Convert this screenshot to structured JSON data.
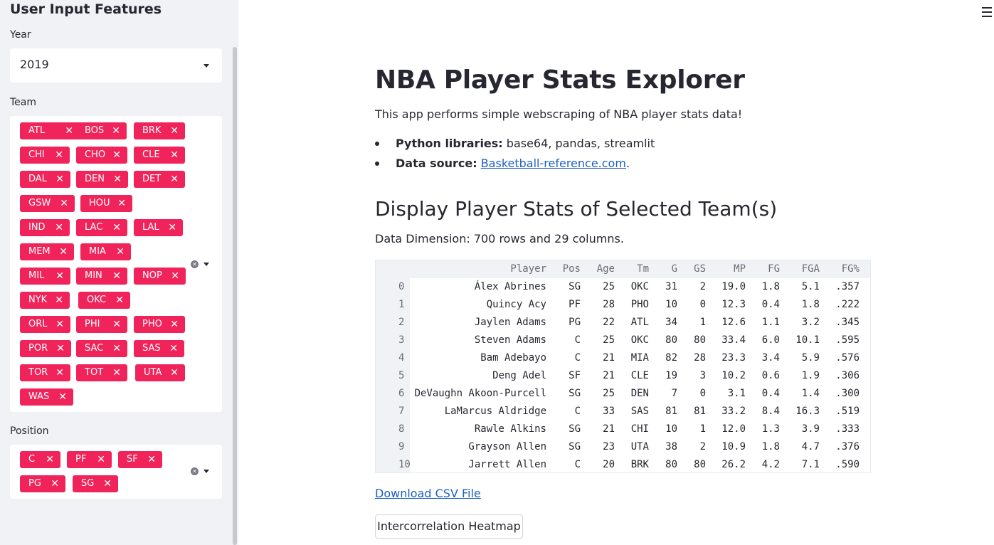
{
  "sidebar": {
    "title": "User Input Features",
    "year_label": "Year",
    "year_value": "2019",
    "team_label": "Team",
    "teams": [
      "ATL",
      "BOS",
      "BRK",
      "CHI",
      "CHO",
      "CLE",
      "DAL",
      "DEN",
      "DET",
      "GSW",
      "HOU",
      "IND",
      "LAC",
      "LAL",
      "MEM",
      "MIA",
      "MIL",
      "MIN",
      "NOP",
      "NYK",
      "OKC",
      "ORL",
      "PHI",
      "PHO",
      "POR",
      "SAC",
      "SAS",
      "TOR",
      "TOT",
      "UTA",
      "WAS"
    ],
    "position_label": "Position",
    "positions": [
      "C",
      "PF",
      "SF",
      "PG",
      "SG"
    ],
    "tag_remove_glyph": "✕",
    "clear_glyph": "✕"
  },
  "main": {
    "title": "NBA Player Stats Explorer",
    "intro": "This app performs simple webscraping of NBA player stats data!",
    "bullets": [
      {
        "bold": "Python libraries:",
        "text": " base64, pandas, streamlit"
      },
      {
        "bold": "Data source:",
        "link": "Basketball-reference.com",
        "suffix": "."
      }
    ],
    "subtitle": "Display Player Stats of Selected Team(s)",
    "dimensions": "Data Dimension: 700 rows and 29 columns.",
    "table": {
      "columns": [
        "Player",
        "Pos",
        "Age",
        "Tm",
        "G",
        "GS",
        "MP",
        "FG",
        "FGA",
        "FG%"
      ],
      "rows": [
        [
          "0",
          "Álex Abrines",
          "SG",
          "25",
          "OKC",
          "31",
          "2",
          "19.0",
          "1.8",
          "5.1",
          ".357"
        ],
        [
          "1",
          "Quincy Acy",
          "PF",
          "28",
          "PHO",
          "10",
          "0",
          "12.3",
          "0.4",
          "1.8",
          ".222"
        ],
        [
          "2",
          "Jaylen Adams",
          "PG",
          "22",
          "ATL",
          "34",
          "1",
          "12.6",
          "1.1",
          "3.2",
          ".345"
        ],
        [
          "3",
          "Steven Adams",
          "C",
          "25",
          "OKC",
          "80",
          "80",
          "33.4",
          "6.0",
          "10.1",
          ".595"
        ],
        [
          "4",
          "Bam Adebayo",
          "C",
          "21",
          "MIA",
          "82",
          "28",
          "23.3",
          "3.4",
          "5.9",
          ".576"
        ],
        [
          "5",
          "Deng Adel",
          "SF",
          "21",
          "CLE",
          "19",
          "3",
          "10.2",
          "0.6",
          "1.9",
          ".306"
        ],
        [
          "6",
          "DeVaughn Akoon-Purcell",
          "SG",
          "25",
          "DEN",
          "7",
          "0",
          "3.1",
          "0.4",
          "1.4",
          ".300"
        ],
        [
          "7",
          "LaMarcus Aldridge",
          "C",
          "33",
          "SAS",
          "81",
          "81",
          "33.2",
          "8.4",
          "16.3",
          ".519"
        ],
        [
          "8",
          "Rawle Alkins",
          "SG",
          "21",
          "CHI",
          "10",
          "1",
          "12.0",
          "1.3",
          "3.9",
          ".333"
        ],
        [
          "9",
          "Grayson Allen",
          "SG",
          "23",
          "UTA",
          "38",
          "2",
          "10.9",
          "1.8",
          "4.7",
          ".376"
        ],
        [
          "10",
          "Jarrett Allen",
          "C",
          "20",
          "BRK",
          "80",
          "80",
          "26.2",
          "4.2",
          "7.1",
          ".590"
        ]
      ]
    },
    "download_link": "Download CSV File",
    "heatmap_button": "Intercorrelation Heatmap"
  },
  "colors": {
    "sidebar_bg": "#f0f2f6",
    "tag_bg": "#f0245a",
    "link": "#1c5fc4",
    "text": "#262730"
  }
}
